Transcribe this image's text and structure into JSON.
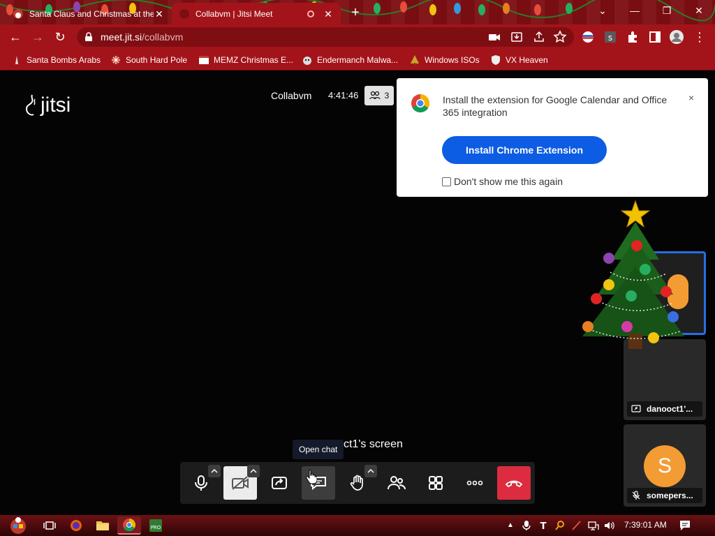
{
  "browser": {
    "tabs": [
      {
        "title": "Santa Claus and Christmas at the",
        "active": false
      },
      {
        "title": "Collabvm | Jitsi Meet",
        "active": true
      }
    ],
    "url_domain": "meet.jit.si",
    "url_path": "/collabvm",
    "bookmarks": [
      {
        "label": "Santa Bombs Arabs",
        "icon": "santa-icon"
      },
      {
        "label": "South Hard Pole",
        "icon": "snowflake-icon"
      },
      {
        "label": "MEMZ Christmas E...",
        "icon": "window-icon"
      },
      {
        "label": "Endermanch Malwa...",
        "icon": "cat-icon"
      },
      {
        "label": "Windows ISOs",
        "icon": "tree-icon"
      },
      {
        "label": "VX Heaven",
        "icon": "shield-icon"
      }
    ]
  },
  "meeting": {
    "logo_text": "jitsi",
    "name": "Collabvm",
    "elapsed": "4:41:46",
    "participant_count": "3",
    "screen_label": "ct1's screen",
    "tooltip": "Open chat"
  },
  "extension_popup": {
    "message": "Install the extension for Google Calendar and Office 365 integration",
    "install_label": "Install Chrome Extension",
    "dont_show_label": "Don't show me this again",
    "close": "×"
  },
  "tiles": [
    {
      "name": ""
    },
    {
      "name": "danooct1'..."
    },
    {
      "name": "somepers...",
      "avatar_letter": "S"
    }
  ],
  "toolbar_buttons": [
    "microphone",
    "camera-off",
    "share-screen",
    "chat",
    "raise-hand",
    "participants",
    "tile-view",
    "more",
    "hangup"
  ],
  "taskbar": {
    "clock": "7:39:01 AM"
  },
  "colors": {
    "browser_red": "#a3141a",
    "accent_blue": "#0c5ce4",
    "hangup_red": "#dd2c40",
    "avatar_orange": "#f39c33"
  }
}
